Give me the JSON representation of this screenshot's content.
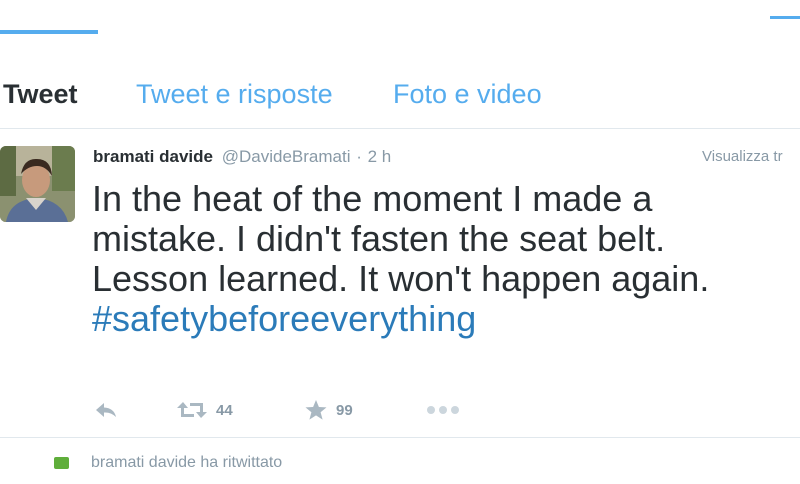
{
  "tabs": {
    "tweet": "Tweet",
    "replies": "Tweet e risposte",
    "media": "Foto e video"
  },
  "tweet": {
    "author_name": "bramati davide",
    "author_handle": "@DavideBramati",
    "separator": "·",
    "timestamp": "2 h",
    "view_link": "Visualizza tr",
    "text_lines": [
      "In the heat of the moment I made a",
      "mistake. I didn't fasten the seat belt.",
      "Lesson learned. It won't happen again."
    ],
    "hashtag": "#safetybeforeeverything",
    "retweet_count": "44",
    "favorite_count": "99"
  },
  "retweet_note": "bramati davide ha ritwittato",
  "colors": {
    "accent": "#55acee",
    "hashtag": "#2b7bb9",
    "text": "#292f33",
    "muted": "#8899a6",
    "retweet_green": "#5fae3b"
  },
  "icons": {
    "reply": "reply-arrow-icon",
    "retweet": "retweet-icon",
    "favorite": "star-icon",
    "more": "more-dots-icon"
  }
}
